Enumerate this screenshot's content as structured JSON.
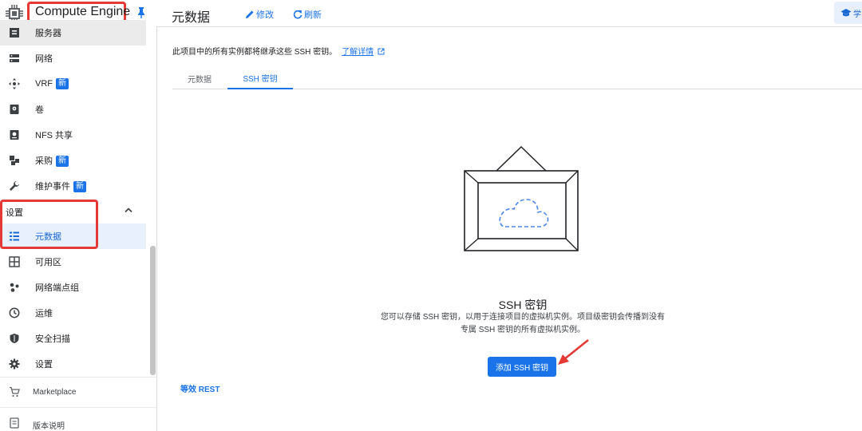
{
  "sidebar": {
    "title": "Compute Engine",
    "items": [
      {
        "label": "服务器",
        "badge": "",
        "icon": "server-icon"
      },
      {
        "label": "网络",
        "badge": "",
        "icon": "network-icon"
      },
      {
        "label": "VRF",
        "badge": "新",
        "icon": "vrf-icon"
      },
      {
        "label": "卷",
        "badge": "",
        "icon": "volume-icon"
      },
      {
        "label": "NFS 共享",
        "badge": "",
        "icon": "nfs-icon"
      },
      {
        "label": "采购",
        "badge": "新",
        "icon": "procurement-icon"
      },
      {
        "label": "维护事件",
        "badge": "新",
        "icon": "wrench-icon"
      }
    ],
    "settings_section": "设置",
    "settings_items": [
      {
        "label": "元数据",
        "icon": "list-icon"
      },
      {
        "label": "可用区",
        "icon": "zones-icon"
      },
      {
        "label": "网络端点组",
        "icon": "endpoint-group-icon"
      },
      {
        "label": "运维",
        "icon": "clock-icon"
      },
      {
        "label": "安全扫描",
        "icon": "shield-icon"
      },
      {
        "label": "设置",
        "icon": "gear-icon"
      }
    ],
    "bottom": {
      "marketplace": "Marketplace",
      "release_notes": "版本说明"
    }
  },
  "topbar": {
    "title": "元数据",
    "edit": "修改",
    "refresh": "刷新",
    "learn": "学"
  },
  "main": {
    "info_text": "此项目中的所有实例都将继承这些 SSH 密钥。",
    "info_link": "了解详情",
    "tabs": [
      "元数据",
      "SSH 密钥"
    ],
    "active_tab": 1,
    "empty_title": "SSH 密钥",
    "empty_desc_line1": "您可以存储 SSH 密钥，以用于连接项目的虚拟机实例。项目级密钥会传播到没有",
    "empty_desc_line2": "专属 SSH 密钥的所有虚拟机实例。",
    "add_button": "添加 SSH 密钥",
    "rest_link": "等效 REST"
  },
  "colors": {
    "accent": "#1a73e8",
    "annotation_red": "#e53935"
  }
}
